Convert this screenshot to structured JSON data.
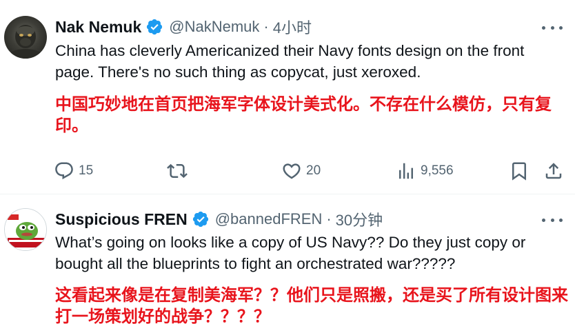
{
  "tweets": [
    {
      "author": {
        "name": "Nak Nemuk",
        "handle": "@NakNemuk",
        "time": "4小时",
        "avatar_icon": "gorilla-avatar-icon"
      },
      "text_en": "China has cleverly Americanized their Navy fonts design on the front page. There's no such thing as copycat, just xeroxed.",
      "text_zh": "中国巧妙地在首页把海军字体设计美式化。不存在什么模仿，只有复印。",
      "stats": {
        "replies": "15",
        "likes": "20",
        "views": "9,556"
      }
    },
    {
      "author": {
        "name": "Suspicious FREN",
        "handle": "@bannedFREN",
        "time": "30分钟",
        "avatar_icon": "pepe-frog-avatar-icon"
      },
      "text_en": "What’s going on looks like a copy of US Navy?? Do they just copy or bought all the blueprints to fight an orchestrated war?????",
      "text_zh": "这看起来像是在复制美海军？？他们只是照搬，还是买了所有设计图来打一场策划好的战争？？？？"
    }
  ],
  "colors": {
    "text": "#0f1419",
    "secondary": "#536471",
    "verified": "#1d9bf0",
    "translation": "#e8141c",
    "divider": "#eff3f4"
  }
}
